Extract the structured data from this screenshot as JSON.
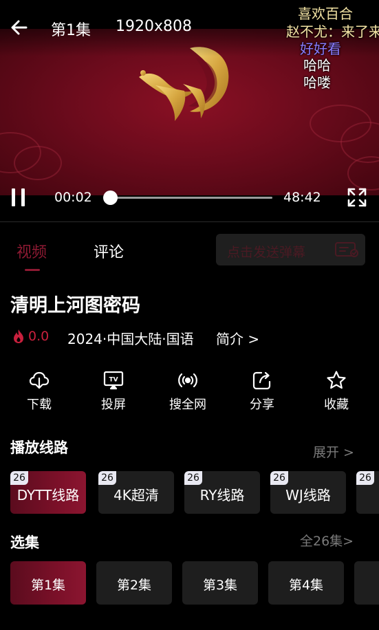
{
  "player": {
    "episode_title": "第1集",
    "resolution": "1920x808",
    "current_time": "00:02",
    "total_time": "48:42",
    "progress": 0.0007,
    "is_playing": true
  },
  "danmaku": [
    {
      "text": "喜欢百合",
      "color": "#f3e3a4"
    },
    {
      "text": "赵不尤：来了来了",
      "color": "#f3e3a4"
    },
    {
      "text": "好好看",
      "color": "#8a7cff"
    },
    {
      "text": "哈哈",
      "color": "#ffffff"
    },
    {
      "text": "哈喽",
      "color": "#ffffff"
    }
  ],
  "tabs": [
    {
      "label": "视频",
      "active": true
    },
    {
      "label": "评论",
      "active": false
    }
  ],
  "danmaku_input": {
    "placeholder": "点击发送弹幕"
  },
  "show": {
    "title": "清明上河图密码",
    "rating": "0.0",
    "meta": "2024·中国大陆·国语",
    "intro_link": "简介 >"
  },
  "actions": [
    {
      "label": "下载",
      "icon": "download-icon"
    },
    {
      "label": "投屏",
      "icon": "tv-cast-icon"
    },
    {
      "label": "搜全网",
      "icon": "broadcast-icon"
    },
    {
      "label": "分享",
      "icon": "share-icon"
    },
    {
      "label": "收藏",
      "icon": "star-icon"
    }
  ],
  "play_lines": {
    "title": "播放线路",
    "expand": "展开 >",
    "items": [
      {
        "badge": "26",
        "label": "DYTT线路",
        "active": true
      },
      {
        "badge": "26",
        "label": "4K超清",
        "active": false
      },
      {
        "badge": "26",
        "label": "RY线路",
        "active": false
      },
      {
        "badge": "26",
        "label": "WJ线路",
        "active": false
      },
      {
        "badge": "26",
        "label": "",
        "active": false
      }
    ]
  },
  "episodes": {
    "title": "选集",
    "all": "全26集>",
    "items": [
      {
        "label": "第1集",
        "active": true
      },
      {
        "label": "第2集",
        "active": false
      },
      {
        "label": "第3集",
        "active": false
      },
      {
        "label": "第4集",
        "active": false
      },
      {
        "label": "",
        "active": false
      }
    ]
  },
  "colors": {
    "accent": "#8e1a33",
    "rating": "#c8203d",
    "background": "#000000",
    "card": "#1e1e1e"
  }
}
